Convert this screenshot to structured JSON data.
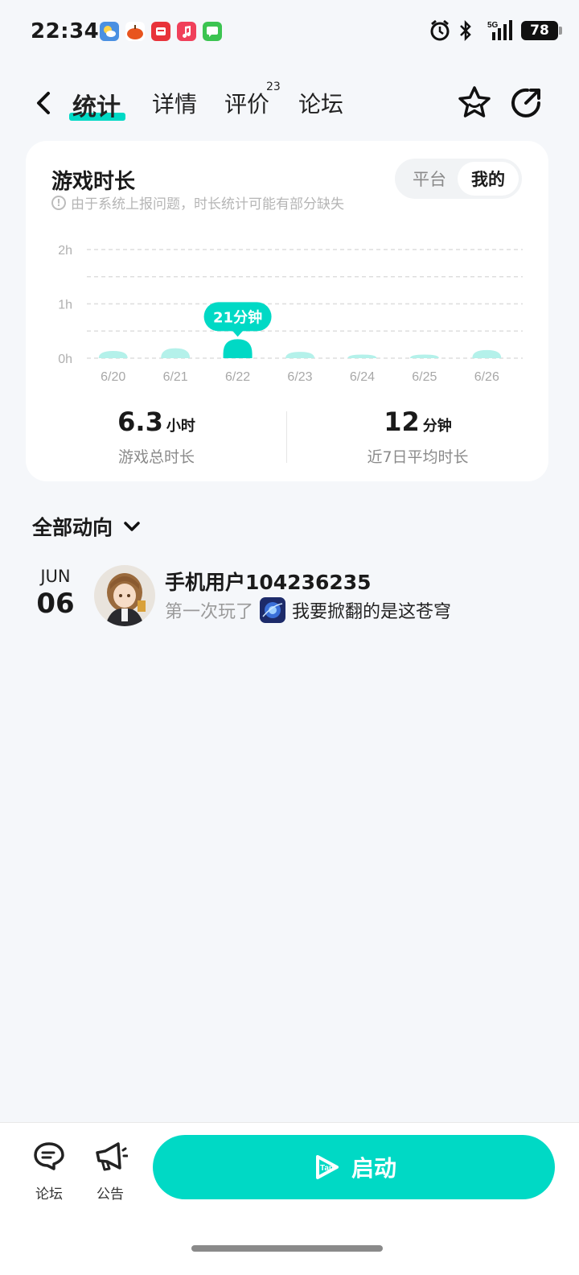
{
  "status_bar": {
    "time": "22:34",
    "battery": "78",
    "network": "5G"
  },
  "nav": {
    "tabs": [
      {
        "label": "统计",
        "active": true
      },
      {
        "label": "详情",
        "active": false
      },
      {
        "label": "评价",
        "active": false,
        "badge": "23"
      },
      {
        "label": "论坛",
        "active": false
      }
    ]
  },
  "playtime": {
    "title": "游戏时长",
    "note": "由于系统上报问题，时长统计可能有部分缺失",
    "toggle": {
      "options": [
        "平台",
        "我的"
      ],
      "selected": "我的"
    },
    "stats": [
      {
        "value": "6.3",
        "unit": "小时",
        "label": "游戏总时长"
      },
      {
        "value": "12",
        "unit": "分钟",
        "label": "近7日平均时长"
      }
    ]
  },
  "chart_data": {
    "type": "bar",
    "categories": [
      "6/20",
      "6/21",
      "6/22",
      "6/23",
      "6/24",
      "6/25",
      "6/26"
    ],
    "values_minutes": [
      8,
      11,
      21,
      7,
      4,
      4,
      9
    ],
    "y_tick_labels": [
      "2h",
      "1h",
      "0h"
    ],
    "ylim_minutes": [
      0,
      120
    ],
    "highlight_index": 2,
    "tooltip": "21分钟",
    "grid": true,
    "colors": {
      "bar": "#b4f1ea",
      "highlight": "#00d9c5"
    }
  },
  "feed": {
    "filter_label": "全部动向",
    "items": [
      {
        "month": "JUN",
        "day": "06",
        "user": "手机用户104236235",
        "action": "第一次玩了",
        "game": "我要掀翻的是这苍穹"
      }
    ]
  },
  "bottom_bar": {
    "forum_label": "论坛",
    "notice_label": "公告",
    "launch_label": "启动",
    "launch_icon_text": "Tap"
  },
  "colors": {
    "accent": "#00d9c5",
    "background": "#f5f7fa"
  }
}
